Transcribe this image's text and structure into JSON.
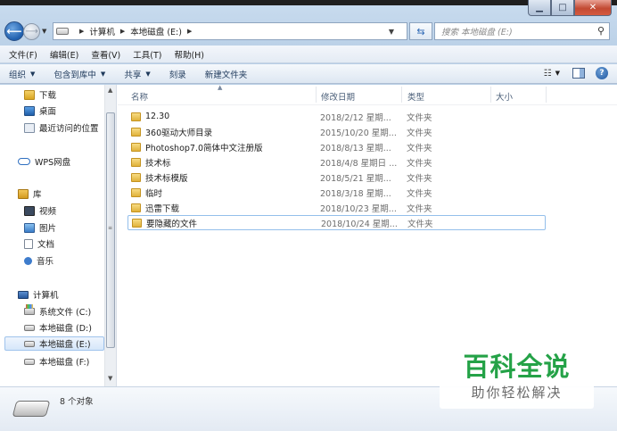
{
  "window": {
    "caption_min": "▁",
    "caption_max": "□",
    "caption_close": "✕"
  },
  "nav": {
    "breadcrumbs": [
      "计算机",
      "本地磁盘 (E:)"
    ],
    "search_placeholder": "搜索 本地磁盘 (E:)"
  },
  "menu": [
    "文件(F)",
    "编辑(E)",
    "查看(V)",
    "工具(T)",
    "帮助(H)"
  ],
  "toolbar": {
    "organize": "组织",
    "include_lib": "包含到库中",
    "share": "共享",
    "burn": "刻录",
    "new_folder": "新建文件夹"
  },
  "sidebar": {
    "favorites": [
      {
        "label": "下载",
        "icon": "download-folder-icon"
      },
      {
        "label": "桌面",
        "icon": "desktop-icon"
      },
      {
        "label": "最近访问的位置",
        "icon": "recent-places-icon"
      }
    ],
    "wps": {
      "label": "WPS网盘",
      "icon": "cloud-icon"
    },
    "library": {
      "label": "库",
      "icon": "library-icon"
    },
    "library_items": [
      {
        "label": "视频",
        "icon": "video-icon"
      },
      {
        "label": "图片",
        "icon": "pictures-icon"
      },
      {
        "label": "文档",
        "icon": "documents-icon"
      },
      {
        "label": "音乐",
        "icon": "music-icon"
      }
    ],
    "computer": {
      "label": "计算机",
      "icon": "computer-icon"
    },
    "drives": [
      {
        "label": "系统文件 (C:)",
        "icon": "system-drive-icon"
      },
      {
        "label": "本地磁盘 (D:)",
        "icon": "drive-icon"
      },
      {
        "label": "本地磁盘 (E:)",
        "icon": "drive-icon"
      },
      {
        "label": "本地磁盘 (F:)",
        "icon": "drive-icon"
      }
    ]
  },
  "columns": {
    "name": "名称",
    "date": "修改日期",
    "type": "类型",
    "size": "大小"
  },
  "files": [
    {
      "name": "12.30",
      "date": "2018/2/12 星期...",
      "type": "文件夹"
    },
    {
      "name": "360驱动大师目录",
      "date": "2015/10/20 星期...",
      "type": "文件夹"
    },
    {
      "name": "Photoshop7.0简体中文注册版",
      "date": "2018/8/13 星期...",
      "type": "文件夹"
    },
    {
      "name": "技术标",
      "date": "2018/4/8 星期日 ...",
      "type": "文件夹"
    },
    {
      "name": "技术标模版",
      "date": "2018/5/21 星期...",
      "type": "文件夹"
    },
    {
      "name": "临时",
      "date": "2018/3/18 星期...",
      "type": "文件夹"
    },
    {
      "name": "迅雷下载",
      "date": "2018/10/23 星期...",
      "type": "文件夹"
    },
    {
      "name": "要隐藏的文件",
      "date": "2018/10/24 星期...",
      "type": "文件夹"
    }
  ],
  "status": {
    "count": "8 个对象"
  },
  "watermark": {
    "title": "百科全说",
    "subtitle": "助你轻松解决"
  }
}
